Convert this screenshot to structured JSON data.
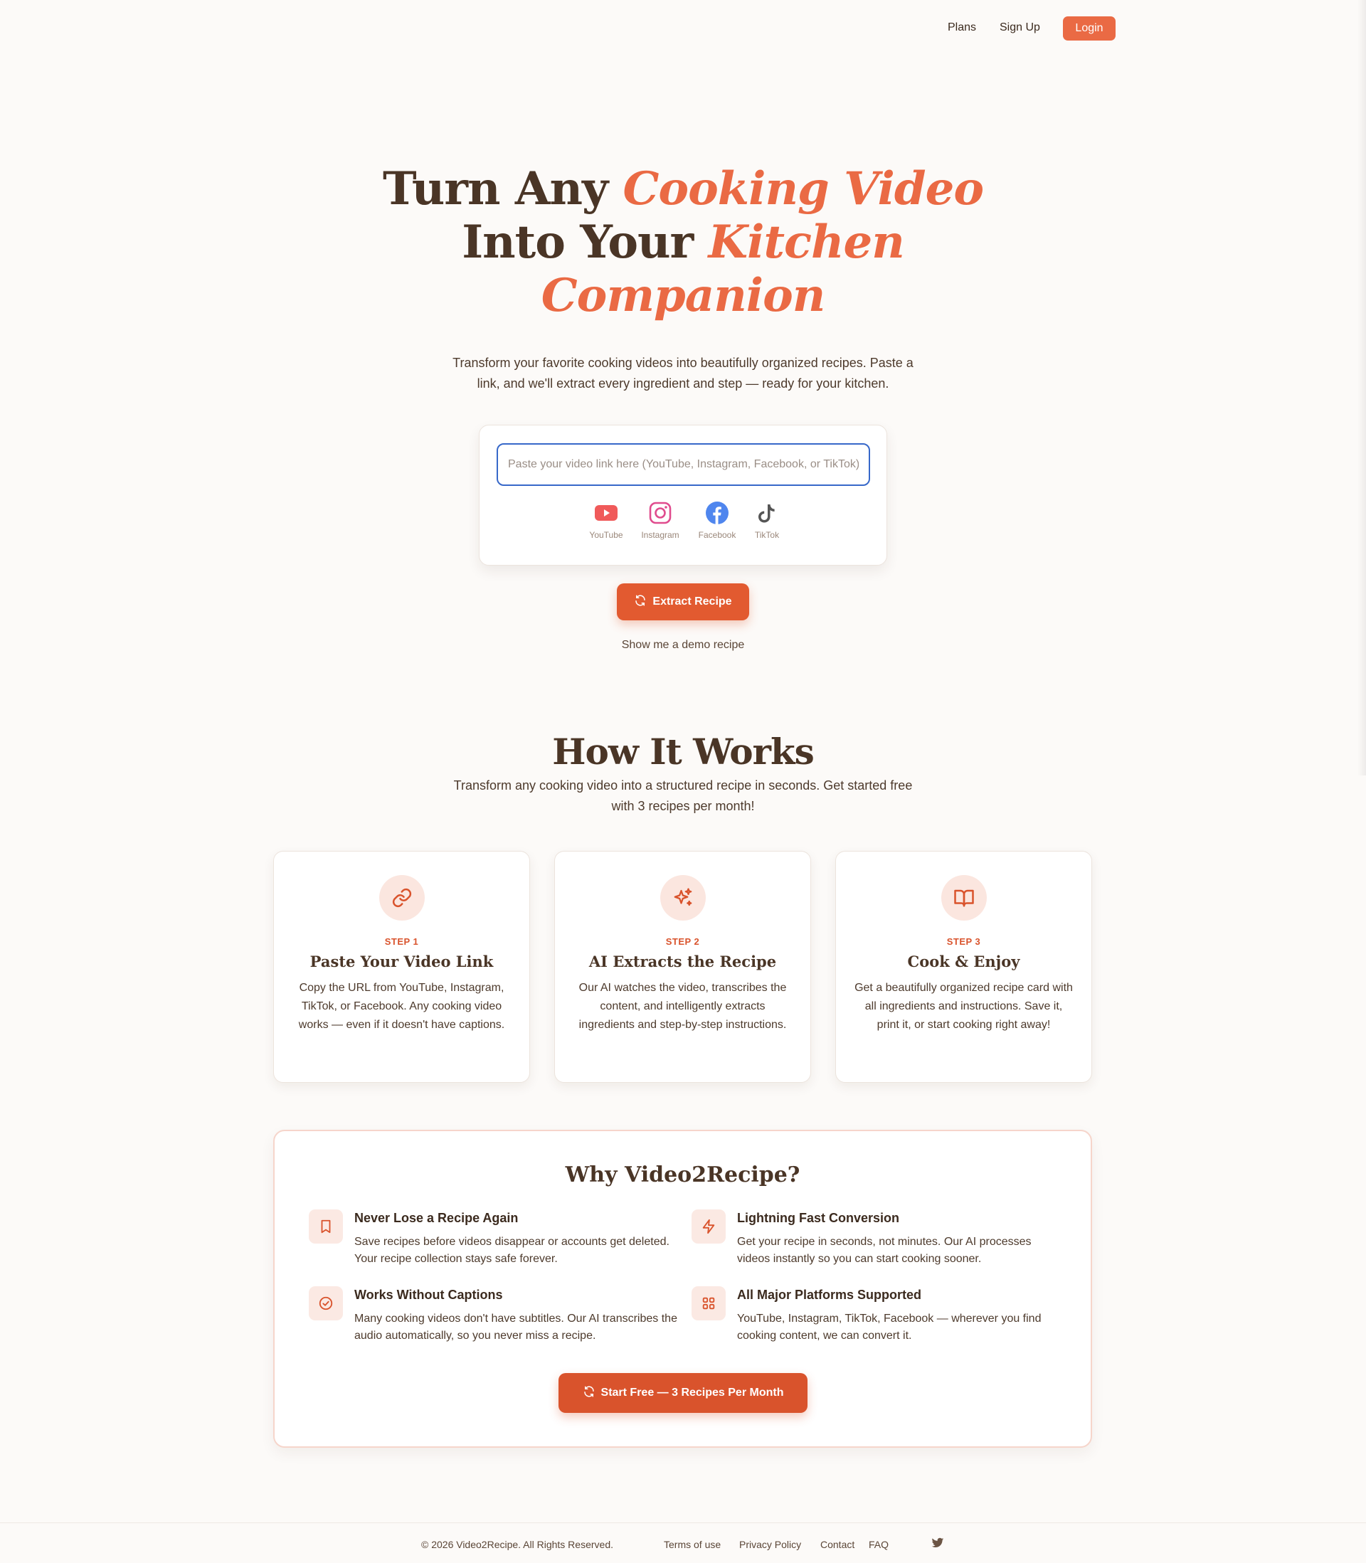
{
  "nav": {
    "plans": "Plans",
    "signup": "Sign Up",
    "login": "Login"
  },
  "hero": {
    "line1_plain": "Turn Any",
    "line1_accent": "Cooking Video",
    "line2_plain": "Into Your",
    "line2_accent": "Kitchen",
    "line3_accent": "Companion",
    "subtitle": "Transform your favorite cooking videos into beautifully organized recipes. Paste a link, and we'll extract every ingredient and step — ready for your kitchen."
  },
  "input": {
    "placeholder": "Paste your video link here (YouTube, Instagram, Facebook, or TikTok)",
    "value": ""
  },
  "platforms": [
    {
      "label": "YouTube",
      "icon": "youtube-icon"
    },
    {
      "label": "Instagram",
      "icon": "instagram-icon"
    },
    {
      "label": "Facebook",
      "icon": "facebook-icon"
    },
    {
      "label": "TikTok",
      "icon": "tiktok-icon"
    }
  ],
  "extract_button": "Extract Recipe",
  "demo_link": "Show me a demo recipe",
  "how": {
    "title": "How It Works",
    "subtitle": "Transform any cooking video into a structured recipe in seconds. Get started free with 3 recipes per month!",
    "steps": [
      {
        "step": "STEP 1",
        "title": "Paste Your Video Link",
        "desc": "Copy the URL from YouTube, Instagram, TikTok, or Facebook. Any cooking video works — even if it doesn't have captions.",
        "icon": "link-icon"
      },
      {
        "step": "STEP 2",
        "title": "AI Extracts the Recipe",
        "desc": "Our AI watches the video, transcribes the content, and intelligently extracts ingredients and step-by-step instructions.",
        "icon": "sparkles-icon"
      },
      {
        "step": "STEP 3",
        "title": "Cook & Enjoy",
        "desc": "Get a beautifully organized recipe card with all ingredients and instructions. Save it, print it, or start cooking right away!",
        "icon": "book-icon"
      }
    ]
  },
  "why": {
    "title": "Why Video2Recipe?",
    "features": [
      {
        "title": "Never Lose a Recipe Again",
        "desc": "Save recipes before videos disappear or accounts get deleted. Your recipe collection stays safe forever.",
        "icon": "bookmark-icon"
      },
      {
        "title": "Lightning Fast Conversion",
        "desc": "Get your recipe in seconds, not minutes. Our AI processes videos instantly so you can start cooking sooner.",
        "icon": "lightning-icon"
      },
      {
        "title": "Works Without Captions",
        "desc": "Many cooking videos don't have subtitles. Our AI transcribes the audio automatically, so you never miss a recipe.",
        "icon": "check-circle-icon"
      },
      {
        "title": "All Major Platforms Supported",
        "desc": "YouTube, Instagram, TikTok, Facebook — wherever you find cooking content, we can convert it.",
        "icon": "grid-icon"
      }
    ],
    "cta": "Start Free — 3 Recipes Per Month"
  },
  "footer": {
    "copyright": "© 2026 Video2Recipe. All Rights Reserved.",
    "links": [
      "Terms of use",
      "Privacy Policy",
      "Contact",
      "FAQ"
    ],
    "social_icon": "twitter-icon"
  },
  "colors": {
    "accent": "#ea6a44",
    "text": "#4a3526",
    "background": "#fcfaf8"
  }
}
